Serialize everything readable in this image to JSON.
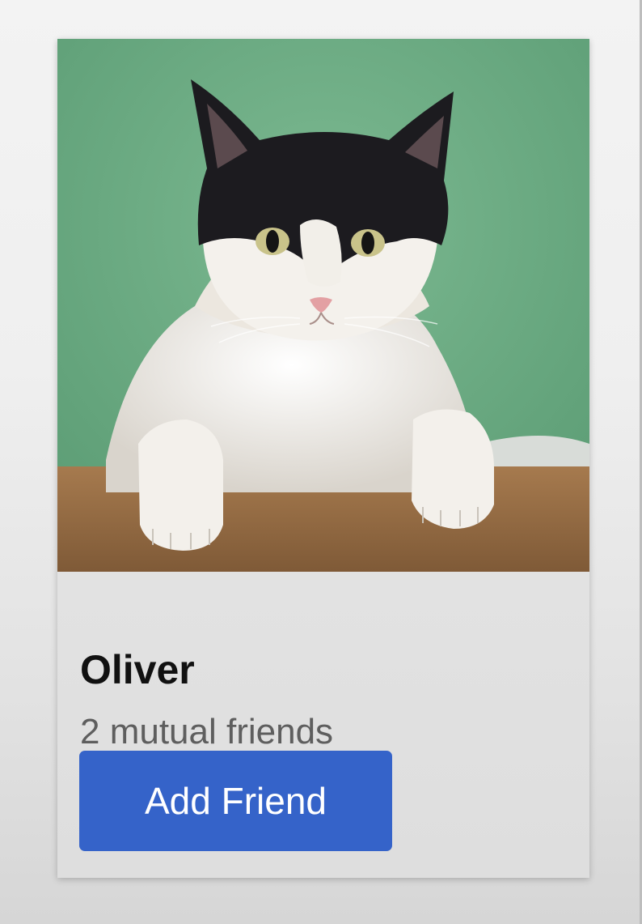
{
  "card": {
    "name": "Oliver",
    "mutual_friends": "2 mutual friends",
    "add_button_label": "Add Friend",
    "photo_alt": "cat",
    "accent_color": "#3563c9"
  }
}
